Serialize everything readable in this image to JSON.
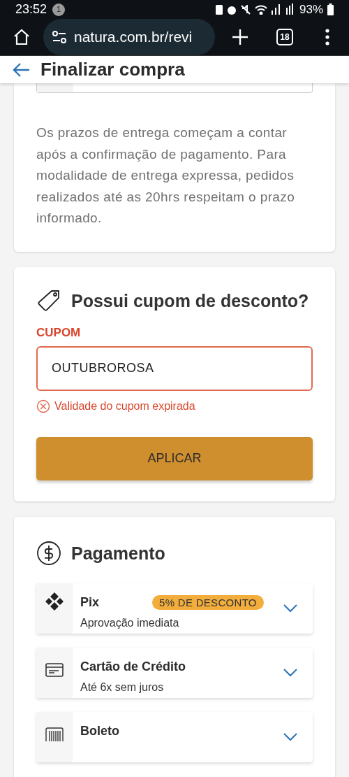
{
  "status_bar": {
    "time": "23:52",
    "notification_count": "1",
    "battery": "93%"
  },
  "browser": {
    "url": "natura.com.br/revi",
    "tab_count": "18"
  },
  "header": {
    "title": "Finalizar compra"
  },
  "delivery": {
    "note": "Os prazos de entrega começam a contar após a confirmação de pagamento. Para modalidade de entrega expressa, pedidos realizados até as 20hrs respeitam o prazo informado."
  },
  "coupon": {
    "title": "Possui cupom de desconto?",
    "label": "CUPOM",
    "value": "OUTUBROROSA",
    "invalid": true,
    "error": "Validade do cupom expirada",
    "button": "APLICAR"
  },
  "payment": {
    "title": "Pagamento",
    "methods": [
      {
        "kind": "pix",
        "title": "Pix",
        "subtitle": "Aprovação imediata",
        "badge": "5% DE DESCONTO",
        "expanded": false
      },
      {
        "kind": "card",
        "title": "Cartão de Crédito",
        "subtitle": "Até 6x sem juros",
        "expanded": false
      },
      {
        "kind": "boleto",
        "title": "Boleto",
        "expanded": false
      }
    ]
  }
}
